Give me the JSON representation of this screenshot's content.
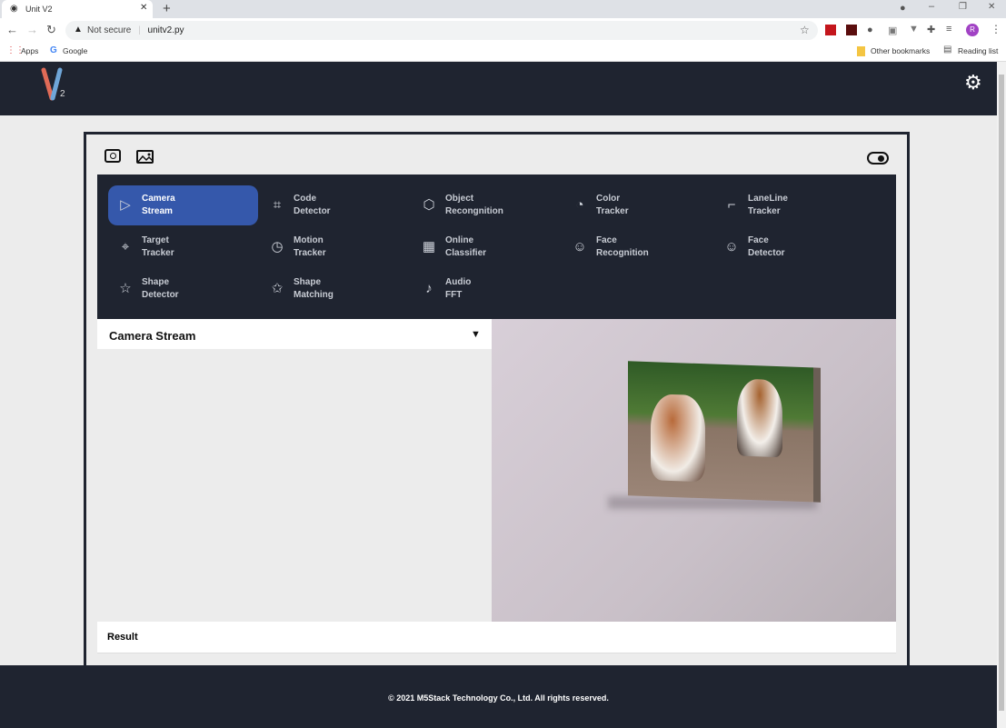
{
  "browser": {
    "tab_title": "Unit V2",
    "security": "Not secure",
    "url": "unitv2.py",
    "bookmarks": [
      "Apps",
      "Google"
    ],
    "other_bookmarks": "Other bookmarks",
    "reading_list": "Reading list",
    "profile_initial": "R"
  },
  "header": {
    "logo_letter": "V",
    "logo_sub": "2"
  },
  "menu": [
    {
      "l1": "Camera",
      "l2": "Stream",
      "icon": "▷"
    },
    {
      "l1": "Code",
      "l2": "Detector",
      "icon": "⌗"
    },
    {
      "l1": "Object",
      "l2": "Recongnition",
      "icon": "⬡"
    },
    {
      "l1": "Color",
      "l2": "Tracker",
      "icon": "◔"
    },
    {
      "l1": "LaneLine",
      "l2": "Tracker",
      "icon": "⌐"
    },
    {
      "l1": "Target",
      "l2": "Tracker",
      "icon": "⌖"
    },
    {
      "l1": "Motion",
      "l2": "Tracker",
      "icon": "◷"
    },
    {
      "l1": "Online",
      "l2": "Classifier",
      "icon": "▦"
    },
    {
      "l1": "Face",
      "l2": "Recognition",
      "icon": "☺"
    },
    {
      "l1": "Face",
      "l2": "Detector",
      "icon": "☺"
    },
    {
      "l1": "Shape",
      "l2": "Detector",
      "icon": "☆"
    },
    {
      "l1": "Shape",
      "l2": "Matching",
      "icon": "✩"
    },
    {
      "l1": "Audio",
      "l2": "FFT",
      "icon": "♪"
    }
  ],
  "selected_function": "Camera Stream",
  "result_label": "Result",
  "footer": "© 2021 M5Stack Technology Co., Ltd. All rights reserved."
}
